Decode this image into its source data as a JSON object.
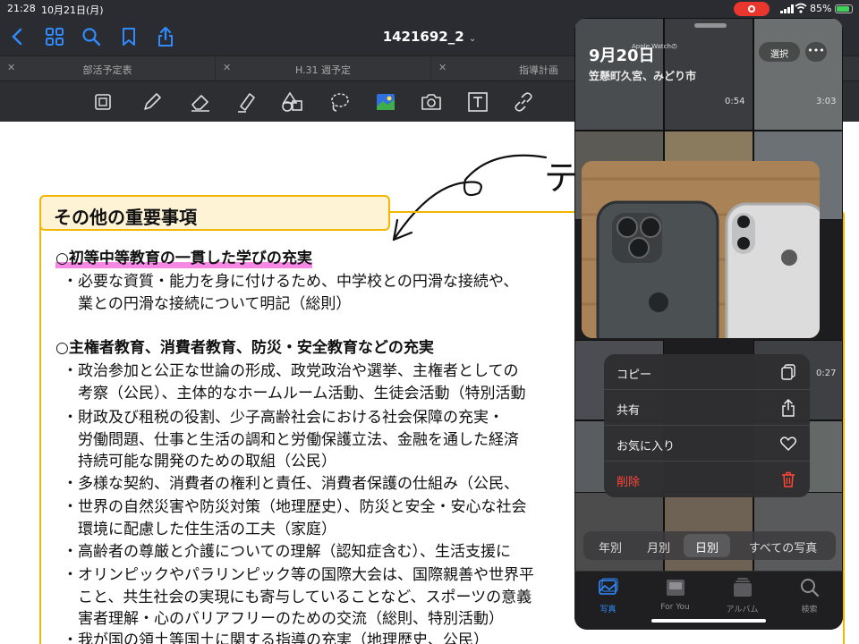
{
  "status_bar": {
    "time": "21:28",
    "date": "10月21日(月)",
    "battery": "85%"
  },
  "app": {
    "title": "1421692_2",
    "title_chevron": "⌄",
    "icons": [
      "back-icon",
      "grid-icon",
      "search-icon",
      "bookmark-icon",
      "share-icon"
    ]
  },
  "tabs": [
    {
      "label": "部活予定表"
    },
    {
      "label": "H.31 週予定"
    },
    {
      "label": "指導計画"
    }
  ],
  "toolbar": {
    "tools": [
      "lasso-select-icon",
      "pen-icon",
      "eraser-icon",
      "highlighter-icon",
      "shapes-icon",
      "lasso-icon",
      "image-icon",
      "camera-icon",
      "text-icon",
      "link-icon"
    ]
  },
  "document": {
    "section_title": "その他の重要事項",
    "overflow_char": "テ",
    "blocks": [
      {
        "heading": "○初等中等教育の一貫した学びの充実",
        "lines": [
          "・必要な資質・能力を身に付けるため、中学校との円滑な接続や、",
          "　業との円滑な接続について明記（総則）"
        ]
      },
      {
        "heading": "○主権者教育、消費者教育、防災・安全教育などの充実",
        "lines": [
          "・政治参加と公正な世論の形成、政党政治や選挙、主権者としての",
          "　考察（公民）、主体的なホームルーム活動、生徒会活動（特別活動",
          "・財政及び租税の役割、少子高齢社会における社会保障の充実・",
          "　労働問題、仕事と生活の調和と労働保護立法、金融を通した経済",
          "　持続可能な開発のための取組（公民）",
          "・多様な契約、消費者の権利と責任、消費者保護の仕組み（公民、",
          "・世界の自然災害や防災対策（地理歴史）、防災と安全・安心な社会",
          "　環境に配慮した住生活の工夫（家庭）",
          "・高齢者の尊厳と介護についての理解（認知症含む）、生活支援に",
          "・オリンピックやパラリンピック等の国際大会は、国際親善や世界平",
          "　こと、共生社会の実現にも寄与していることなど、スポーツの意義",
          "　害者理解・心のバリアフリーのための交流（総則、特別活動）",
          "・我が国の領土等国土に関する指導の充実（地理歴史、公民）"
        ]
      }
    ]
  },
  "photos": {
    "date": "9月20日",
    "location": "笠懸町久宮、みどり市",
    "select_label": "選択",
    "more_label": "•••",
    "watch_caption": "Apple Watchの",
    "durations": [
      "0:54",
      "3:03",
      "0:27"
    ],
    "context_menu": [
      {
        "label": "コピー",
        "icon": "copy-icon"
      },
      {
        "label": "共有",
        "icon": "share-icon"
      },
      {
        "label": "お気に入り",
        "icon": "heart-icon"
      },
      {
        "label": "削除",
        "icon": "trash-icon",
        "destructive": true
      }
    ],
    "segments": [
      {
        "label": "年別"
      },
      {
        "label": "月別"
      },
      {
        "label": "日別",
        "active": true
      },
      {
        "label": "すべての写真"
      }
    ],
    "tab_bar": [
      {
        "label": "写真",
        "icon": "photos-icon",
        "active": true
      },
      {
        "label": "For You",
        "icon": "for-you-icon"
      },
      {
        "label": "アルバム",
        "icon": "albums-icon"
      },
      {
        "label": "検索",
        "icon": "search-icon"
      }
    ]
  },
  "colors": {
    "accent_blue": "#2f8bff",
    "section_border": "#f2b700",
    "highlight": "#f460dc",
    "danger": "#ff453a"
  }
}
